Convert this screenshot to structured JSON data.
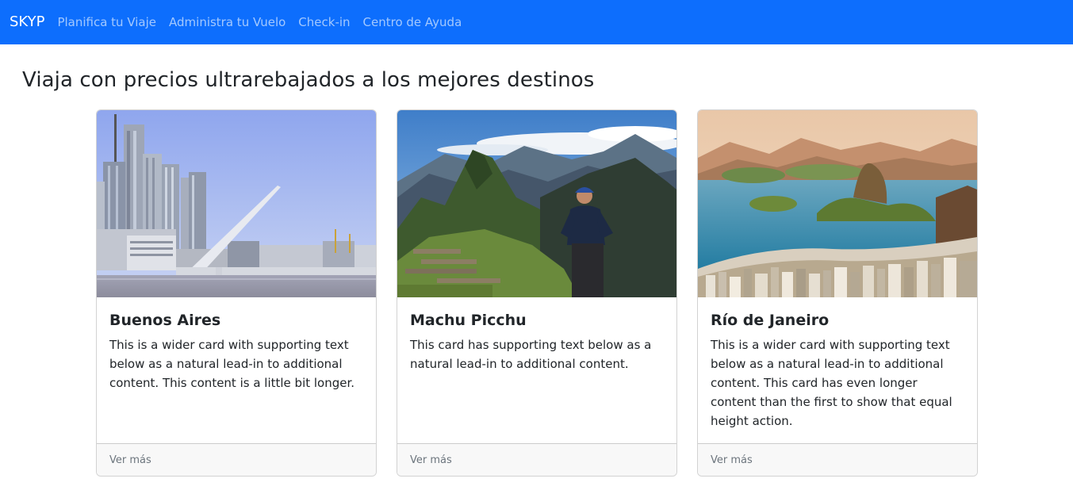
{
  "navbar": {
    "brand": "SKYP",
    "links": [
      {
        "label": "Planifica tu Viaje"
      },
      {
        "label": "Administra tu Vuelo"
      },
      {
        "label": "Check-in"
      },
      {
        "label": "Centro de Ayuda"
      }
    ]
  },
  "page": {
    "title": "Viaja con precios ultrarebajados a los mejores destinos"
  },
  "cards": [
    {
      "title": "Buenos Aires",
      "text": "This is a wider card with supporting text below as a natural lead-in to additional content. This content is a little bit longer.",
      "footer": "Ver más"
    },
    {
      "title": "Machu Picchu",
      "text": "This card has supporting text below as a natural lead-in to additional content.",
      "footer": "Ver más"
    },
    {
      "title": "Río de Janeiro",
      "text": "This is a wider card with supporting text below as a natural lead-in to additional content. This card has even longer content than the first to show that equal height action.",
      "footer": "Ver más"
    }
  ],
  "colors": {
    "navbar_bg": "#0d6efd",
    "footer_bg": "#f8f8f8"
  }
}
